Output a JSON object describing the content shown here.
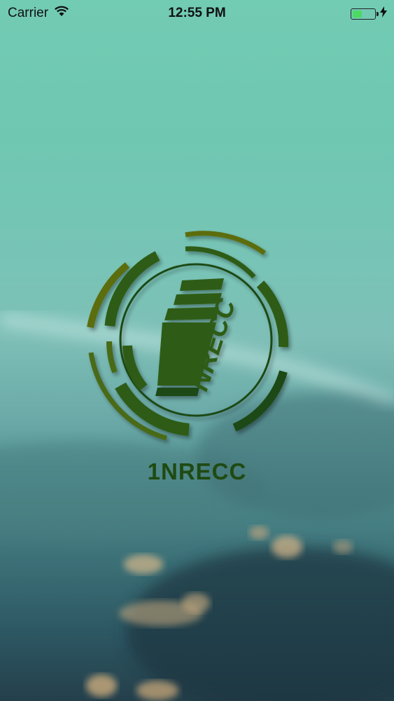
{
  "status_bar": {
    "carrier": "Carrier",
    "time": "12:55 PM",
    "battery_level": 0.45,
    "battery_color": "#4cd964"
  },
  "icons": {
    "wifi": "wifi-icon",
    "charging": "charging-bolt-icon",
    "logo": "1nrecc-logo-icon"
  },
  "splash": {
    "app_name": "1NRECC",
    "logo_color": "#2f5b14"
  }
}
